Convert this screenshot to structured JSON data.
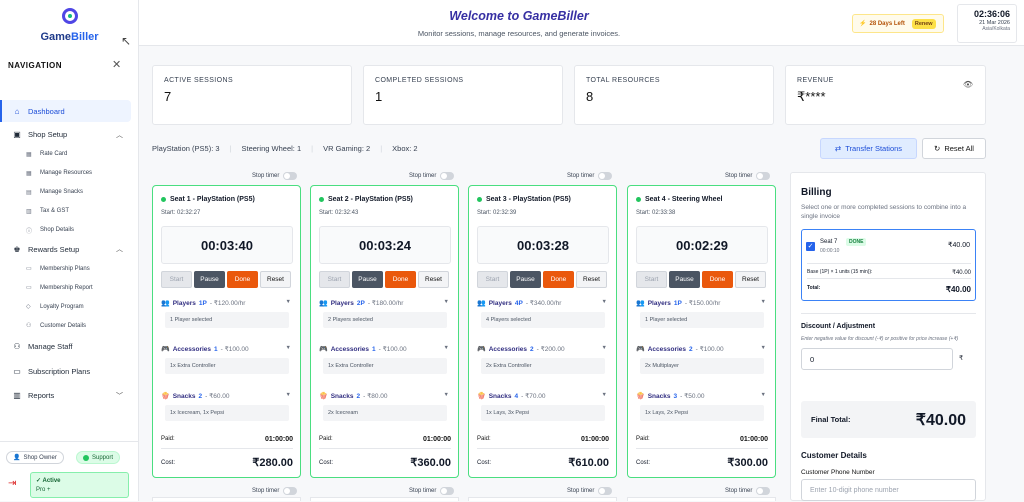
{
  "app": {
    "logo_text_1": "Game",
    "logo_text_2": "Biller"
  },
  "nav": {
    "heading": "NAVIGATION",
    "close_icon": "close-icon",
    "items": [
      {
        "label": "Dashboard",
        "icon": "home-icon",
        "active": true
      },
      {
        "label": "Shop Setup",
        "icon": "shop-icon",
        "expanded": true,
        "children": [
          {
            "label": "Rate Card",
            "icon": "grid-icon"
          },
          {
            "label": "Manage Resources",
            "icon": "resources-icon"
          },
          {
            "label": "Manage Snacks",
            "icon": "snacks-icon"
          },
          {
            "label": "Tax & GST",
            "icon": "tax-icon"
          },
          {
            "label": "Shop Details",
            "icon": "info-icon"
          }
        ]
      },
      {
        "label": "Rewards Setup",
        "icon": "rewards-icon",
        "expanded": true,
        "children": [
          {
            "label": "Membership Plans",
            "icon": "plans-icon"
          },
          {
            "label": "Membership Report",
            "icon": "report-icon"
          },
          {
            "label": "Loyalty Program",
            "icon": "loyalty-icon"
          },
          {
            "label": "Customer Details",
            "icon": "customers-icon"
          }
        ]
      },
      {
        "label": "Manage Staff",
        "icon": "staff-icon"
      },
      {
        "label": "Subscription Plans",
        "icon": "subscription-icon"
      },
      {
        "label": "Reports",
        "icon": "reports-icon",
        "collapsible": true
      }
    ]
  },
  "footer": {
    "role": "Shop Owner",
    "support": "Support",
    "plan_status": "Active",
    "plan_name": "Pro +"
  },
  "header": {
    "welcome": "Welcome to GameBiller",
    "subtitle": "Monitor sessions, manage resources, and generate invoices.",
    "days_left": "28 Days Left",
    "renew": "Renew",
    "time": "02:36:06",
    "date": "21 Mar 2026",
    "timezone": "Asia/Kolkata"
  },
  "stats": [
    {
      "label": "ACTIVE SESSIONS",
      "value": "7"
    },
    {
      "label": "COMPLETED SESSIONS",
      "value": "1"
    },
    {
      "label": "TOTAL RESOURCES",
      "value": "8"
    },
    {
      "label": "REVENUE",
      "value": "₹****"
    }
  ],
  "summary": [
    "PlayStation (PS5): 3",
    "Steering Wheel: 1",
    "VR Gaming: 2",
    "Xbox: 2"
  ],
  "actions": {
    "transfer": "Transfer Stations",
    "reset_all": "Reset All",
    "stop_timer": "Stop timer"
  },
  "controls": {
    "start": "Start",
    "pause": "Pause",
    "done": "Done",
    "reset": "Reset",
    "paid": "Paid:",
    "cost": "Cost:"
  },
  "cards": [
    {
      "title": "Seat 1 - PlayStation (PS5)",
      "start": "Start: 02:32:27",
      "timer": "00:03:40",
      "players": {
        "label": "Players",
        "count": "1P",
        "price": "- ₹120.00/hr",
        "detail": "1 Player selected"
      },
      "accessories": {
        "label": "Accessories",
        "count": "1",
        "price": "- ₹100.00",
        "detail": "1x Extra Controller"
      },
      "snacks": {
        "label": "Snacks",
        "count": "2",
        "price": "- ₹60.00",
        "detail": "1x Icecream, 1x Pepsi"
      },
      "paid": "01:00:00",
      "cost": "₹280.00"
    },
    {
      "title": "Seat 2 - PlayStation (PS5)",
      "start": "Start: 02:32:43",
      "timer": "00:03:24",
      "players": {
        "label": "Players",
        "count": "2P",
        "price": "- ₹180.00/hr",
        "detail": "2 Players selected"
      },
      "accessories": {
        "label": "Accessories",
        "count": "1",
        "price": "- ₹100.00",
        "detail": "1x Extra Controller"
      },
      "snacks": {
        "label": "Snacks",
        "count": "2",
        "price": "- ₹80.00",
        "detail": "2x Icecream"
      },
      "paid": "01:00:00",
      "cost": "₹360.00"
    },
    {
      "title": "Seat 3 - PlayStation (PS5)",
      "start": "Start: 02:32:39",
      "timer": "00:03:28",
      "players": {
        "label": "Players",
        "count": "4P",
        "price": "- ₹340.00/hr",
        "detail": "4 Players selected"
      },
      "accessories": {
        "label": "Accessories",
        "count": "2",
        "price": "- ₹200.00",
        "detail": "2x Extra Controller"
      },
      "snacks": {
        "label": "Snacks",
        "count": "4",
        "price": "- ₹70.00",
        "detail": "1x Lays, 3x Pepsi"
      },
      "paid": "01:00:00",
      "cost": "₹610.00"
    },
    {
      "title": "Seat 4 - Steering Wheel",
      "start": "Start: 02:33:38",
      "timer": "00:02:29",
      "players": {
        "label": "Players",
        "count": "1P",
        "price": "- ₹150.00/hr",
        "detail": "1 Player selected"
      },
      "accessories": {
        "label": "Accessories",
        "count": "2",
        "price": "- ₹100.00",
        "detail": "2x Multiplayer"
      },
      "snacks": {
        "label": "Snacks",
        "count": "3",
        "price": "- ₹50.00",
        "detail": "1x Lays, 2x Pepsi"
      },
      "paid": "01:00:00",
      "cost": "₹300.00"
    }
  ],
  "billing": {
    "title": "Billing",
    "hint": "Select one or more completed sessions to combine into a single invoice",
    "item": {
      "seat": "Seat 7",
      "badge": "DONE",
      "time": "00:00:10",
      "amount": "₹40.00",
      "base_label": "Base (1P) × 1 units (15 min)):",
      "base_value": "₹40.00",
      "total_label": "Total:",
      "total_value": "₹40.00"
    },
    "discount_title": "Discount / Adjustment",
    "discount_note": "Enter negative value for discount (-₹) or positive for price increase (+₹)",
    "discount_value": "0",
    "currency": "₹",
    "final_label": "Final Total:",
    "final_value": "₹40.00",
    "customer_title": "Customer Details",
    "phone_label": "Customer Phone Number",
    "phone_placeholder": "Enter 10-digit phone number"
  }
}
